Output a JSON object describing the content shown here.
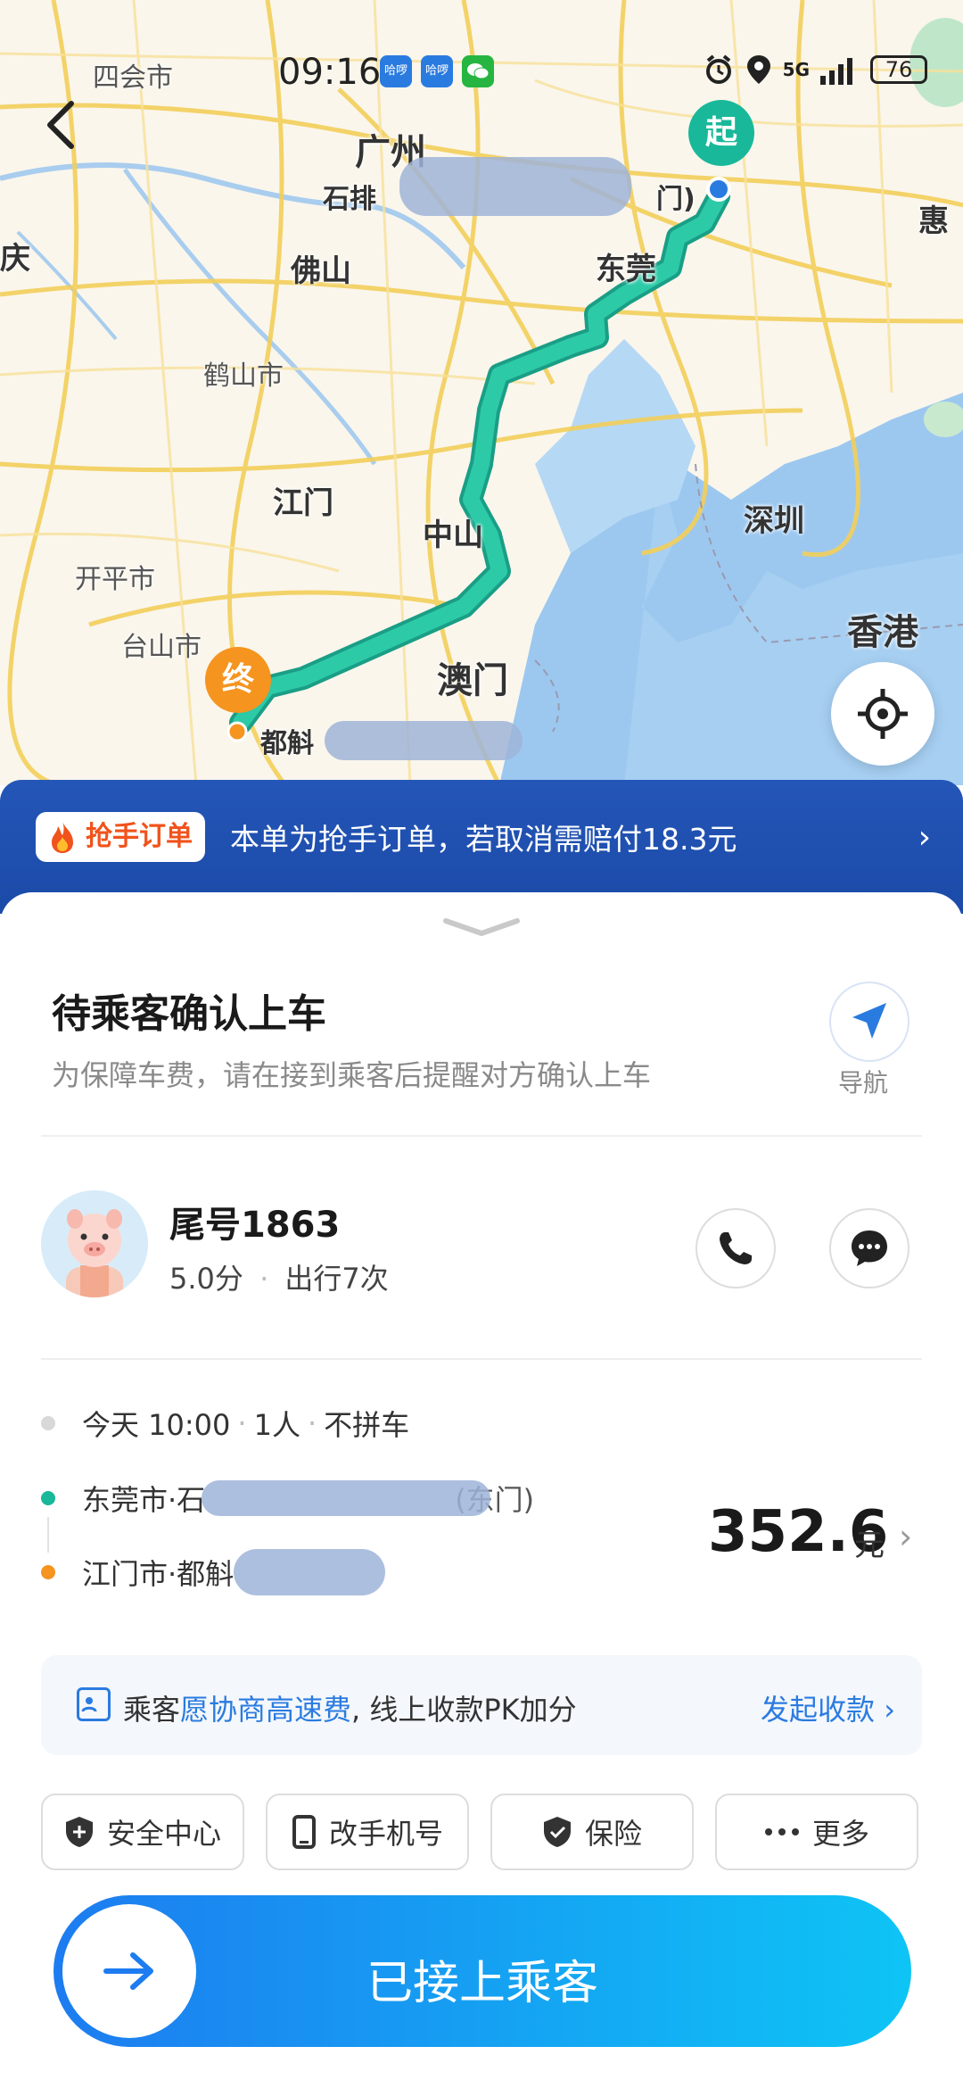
{
  "status_bar": {
    "time": "09:16",
    "battery": "76",
    "network": "5G",
    "app_icon_1": "哈啰",
    "app_icon_2": "哈啰"
  },
  "map": {
    "cities": {
      "sihui": "四会市",
      "guangzhou": "广州",
      "shipai": "石排",
      "foshan": "佛山",
      "dongguan": "东莞",
      "huizhou": "惠",
      "zhaoqing": "庆",
      "heshan": "鹤山市",
      "jiangmen": "江门",
      "zhongshan": "中山",
      "shenzhen": "深圳",
      "kaiping": "开平市",
      "taishan": "台山市",
      "macau": "澳门",
      "hongkong": "香港",
      "start_label_partial": "门)",
      "end_label_partial": "都斛"
    },
    "start_marker": "起",
    "end_marker": "终"
  },
  "banner": {
    "badge": "抢手订单",
    "text": "本单为抢手订单，若取消需赔付18.3元"
  },
  "order": {
    "title": "待乘客确认上车",
    "subtitle": "为保障车费，请在接到乘客后提醒对方确认上车",
    "nav_label": "导航"
  },
  "passenger": {
    "name": "尾号1863",
    "rating": "5.0分",
    "trips": "出行7次"
  },
  "trip": {
    "time": "今天 10:00",
    "people": "1人",
    "share": "不拼车",
    "origin": "东莞市·石",
    "origin_tail": "(东门)",
    "destination": "江门市·都斛",
    "price": "352.6",
    "price_unit": "元"
  },
  "fee": {
    "prefix": "乘客",
    "highlight": "愿协商高速费",
    "suffix": ", 线上收款PK加分",
    "action": "发起收款"
  },
  "actions": {
    "safety": "安全中心",
    "phone": "改手机号",
    "insurance": "保险",
    "more": "更多"
  },
  "main_button": "已接上乘客",
  "colors": {
    "route": "#19b89a",
    "start": "#19b89a",
    "end": "#f5941f",
    "banner": "#1b4aa8",
    "accent": "#2a7be0"
  }
}
